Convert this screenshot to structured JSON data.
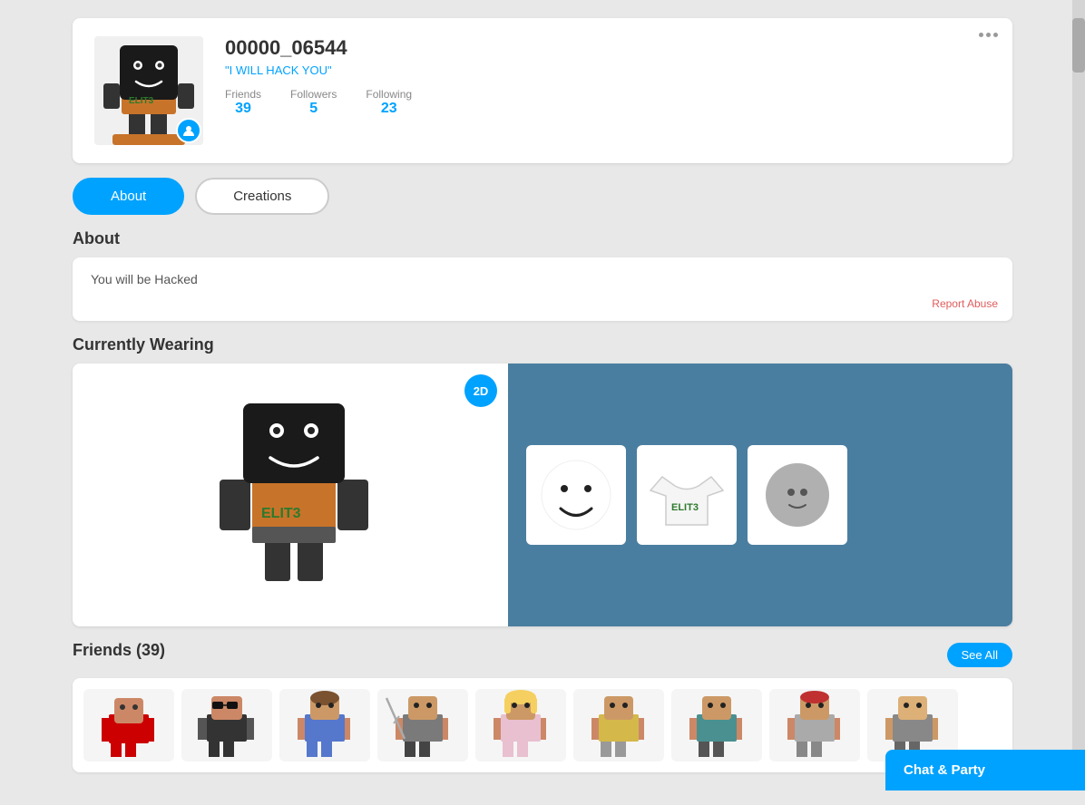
{
  "profile": {
    "username": "00000_06544",
    "status": "\"I WILL HACK YOU\"",
    "friends_label": "Friends",
    "friends_count": "39",
    "followers_label": "Followers",
    "followers_count": "5",
    "following_label": "Following",
    "following_count": "23",
    "menu_dots": "···"
  },
  "tabs": {
    "about_label": "About",
    "creations_label": "Creations"
  },
  "about": {
    "heading": "About",
    "bio": "You will be Hacked",
    "report_abuse": "Report Abuse"
  },
  "wearing": {
    "heading": "Currently Wearing",
    "badge_2d": "2D"
  },
  "friends": {
    "heading": "Friends (39)",
    "see_all": "See All"
  },
  "chat_bar": {
    "label": "Chat & Party"
  }
}
